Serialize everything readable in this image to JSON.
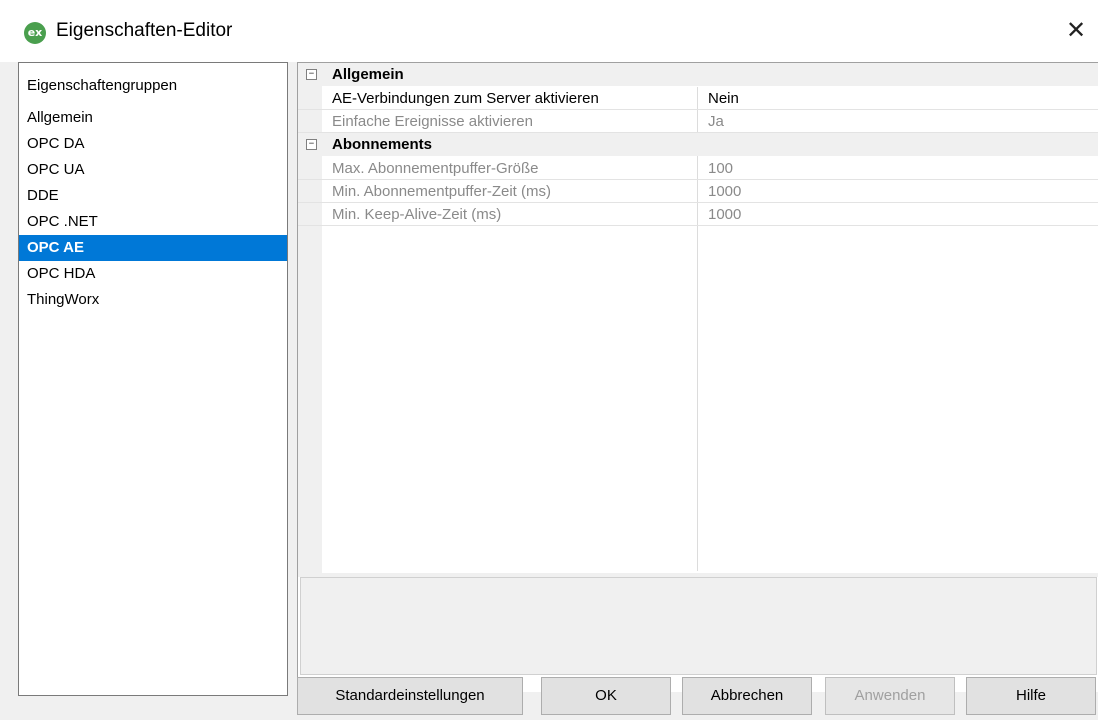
{
  "window": {
    "title": "Eigenschaften-Editor",
    "app_icon_text": "ex",
    "close_glyph": "✕"
  },
  "groups": {
    "header": "Eigenschaftengruppen",
    "items": [
      "Allgemein",
      "OPC DA",
      "OPC UA",
      "DDE",
      "OPC .NET",
      "OPC AE",
      "OPC HDA",
      "ThingWorx"
    ],
    "selected": "OPC AE"
  },
  "grid": {
    "categories": [
      {
        "title": "Allgemein",
        "toggle": "−",
        "properties": [
          {
            "name": "AE-Verbindungen zum Server aktivieren",
            "value": "Nein"
          },
          {
            "name": "Einfache Ereignisse aktivieren",
            "value": "Ja"
          }
        ]
      },
      {
        "title": "Abonnements",
        "toggle": "−",
        "properties": [
          {
            "name": "Max. Abonnementpuffer-Größe",
            "value": "100"
          },
          {
            "name": "Min. Abonnementpuffer-Zeit (ms)",
            "value": "1000"
          },
          {
            "name": "Min. Keep-Alive-Zeit (ms)",
            "value": "1000"
          }
        ]
      }
    ]
  },
  "buttons": {
    "defaults": "Standardeinstellungen",
    "ok": "OK",
    "cancel": "Abbrechen",
    "apply": "Anwenden",
    "help": "Hilfe"
  },
  "colors": {
    "selection": "#0078d7",
    "icon_green": "#4a9f4e"
  }
}
